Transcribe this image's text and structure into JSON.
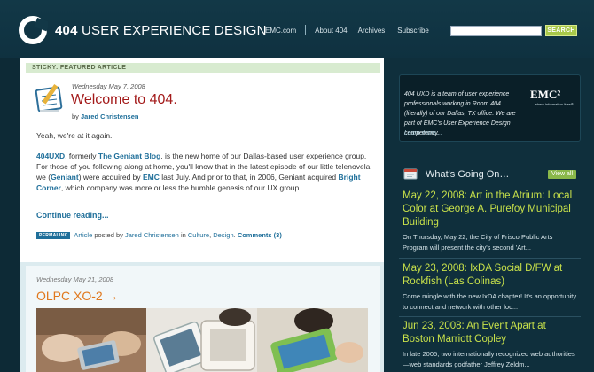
{
  "header": {
    "logo_bold": "404",
    "logo_rest": "USER EXPERIENCE DESIGN",
    "nav": [
      "EMC.com",
      "About 404",
      "Archives",
      "Subscribe"
    ],
    "search_placeholder": "",
    "search_button": "SEARCH"
  },
  "sticky": {
    "label": "STICKY: FEATURED ARTICLE",
    "date": "Wednesday May 7, 2008",
    "title": "Welcome to 404.",
    "by": "by",
    "author": "Jared Christensen",
    "p1": "Yeah, we're at it again.",
    "p2": {
      "a": "404UXD",
      "b": ", formerly ",
      "c": "The Geniant Blog",
      "d": ", is the new home of our Dallas-based user experience group. For those of you following along at home, you'll know that in the latest episode of our little telenovela we (",
      "e": "Geniant",
      "f": ") were acquired by ",
      "g": "EMC",
      "h": " last July. And prior to that, in 2006, Geniant acquired ",
      "i": "Bright Corner",
      "j": ", which company was more or less the humble genesis of our UX group."
    },
    "continue": "Continue reading...",
    "meta": {
      "badge": "PERMALINK",
      "article": "Article",
      "posted_by": "posted by",
      "author": "Jared Christensen",
      "in": "in",
      "cat1": "Culture",
      "comma": ",",
      "cat2": "Design",
      "dot": ".",
      "comments": "Comments (3)"
    }
  },
  "second_post": {
    "date": "Wednesday May 21, 2008",
    "title": "OLPC XO-2 →"
  },
  "sidebar": {
    "about_text": "404 UXD is a team of user experience professionals working in Room 404 (literally) of our Dallas, TX office. We are part of EMC's User Experience Design competency.",
    "learn_more": "Learn more…",
    "emc_logo": "EMC²",
    "emc_tagline": "where information lives®",
    "whats_title": "What's Going On…",
    "view_all": "View all",
    "events": [
      {
        "title": "May 22, 2008: Art in the Atrium: Local Color at George A. Purefoy Municipal Building",
        "desc": "On Thursday, May 22, the City of Frisco Public Arts Program will present the city's second 'Art..."
      },
      {
        "title": "May 23, 2008: IxDA Social D/FW at Rockfish (Las Colinas)",
        "desc": "Come mingle with the new IxDA chapter! It's an opportunity to connect and network with other loc..."
      },
      {
        "title": "Jun 23, 2008: An Event Apart at Boston Marriott Copley",
        "desc": "In late 2005, two internationally recognized web authorities—web standards godfather Jeffrey Zeldm..."
      }
    ]
  },
  "colors": {
    "background": "#0d2a36",
    "title_red": "#a31a1a",
    "link_blue": "#1f6f9a",
    "event_green": "#c8e14a",
    "post_orange": "#e0781d"
  }
}
